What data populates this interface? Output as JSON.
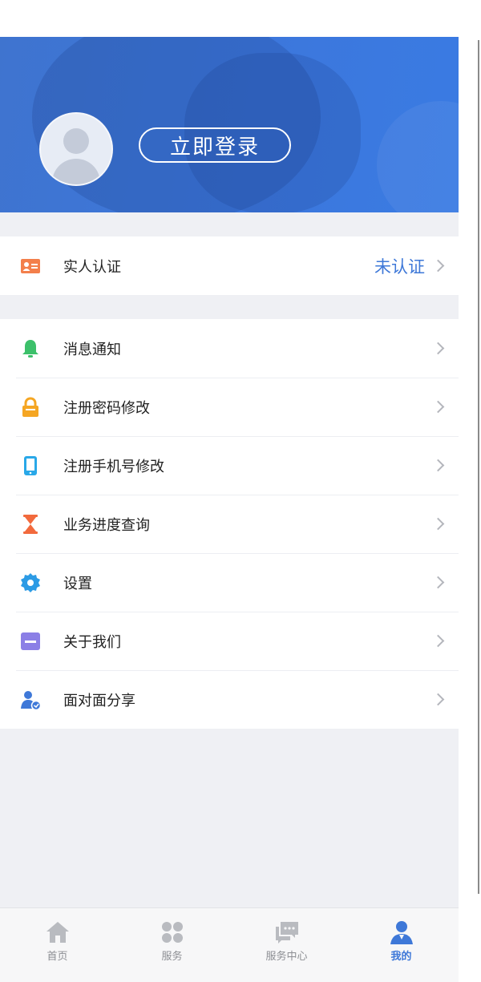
{
  "header": {
    "login_label": "立即登录"
  },
  "verification": {
    "label": "实人认证",
    "status": "未认证",
    "icon": "id-card-icon",
    "icon_color": "#f37f4b"
  },
  "menu": [
    {
      "label": "消息通知",
      "icon": "bell-icon",
      "color": "#3cc06a"
    },
    {
      "label": "注册密码修改",
      "icon": "lock-icon",
      "color": "#f5a623"
    },
    {
      "label": "注册手机号修改",
      "icon": "phone-icon",
      "color": "#29a8e8"
    },
    {
      "label": "业务进度查询",
      "icon": "hourglass-icon",
      "color": "#f26a3d"
    },
    {
      "label": "设置",
      "icon": "gear-icon",
      "color": "#2c9be5"
    },
    {
      "label": "关于我们",
      "icon": "info-card-icon",
      "color": "#8b7fe6"
    },
    {
      "label": "面对面分享",
      "icon": "share-user-icon",
      "color": "#3e78d8"
    }
  ],
  "tabbar": [
    {
      "label": "首页",
      "icon": "home-icon"
    },
    {
      "label": "服务",
      "icon": "grid-icon"
    },
    {
      "label": "服务中心",
      "icon": "chat-icon"
    },
    {
      "label": "我的",
      "icon": "user-icon",
      "active": true
    }
  ],
  "colors": {
    "accent": "#3e78d8",
    "banner": "#3c77dc",
    "background": "#eff0f4"
  }
}
